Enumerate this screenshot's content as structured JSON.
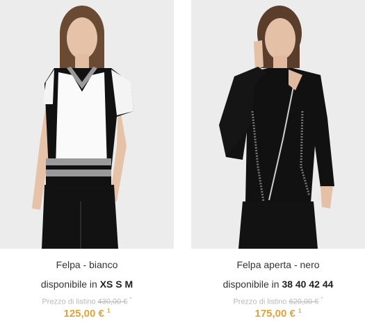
{
  "colors": {
    "price": "#e2a339",
    "list_price": "#b9b9b9",
    "background": "#ececec"
  },
  "products": [
    {
      "image": "model-white-black-top",
      "name": "Felpa - bianco",
      "availability_prefix": "disponibile in",
      "sizes": "XS S M",
      "list_label": "Prezzo di listino",
      "list_price": "430,00 €",
      "list_marker": "*",
      "price": "125,00 €",
      "price_marker": "1"
    },
    {
      "image": "model-black-zip-jacket",
      "name": "Felpa aperta - nero",
      "availability_prefix": "disponibile in",
      "sizes": "38 40 42 44",
      "list_label": "Prezzo di listino",
      "list_price": "620,00 €",
      "list_marker": "*",
      "price": "175,00 €",
      "price_marker": "1"
    }
  ]
}
